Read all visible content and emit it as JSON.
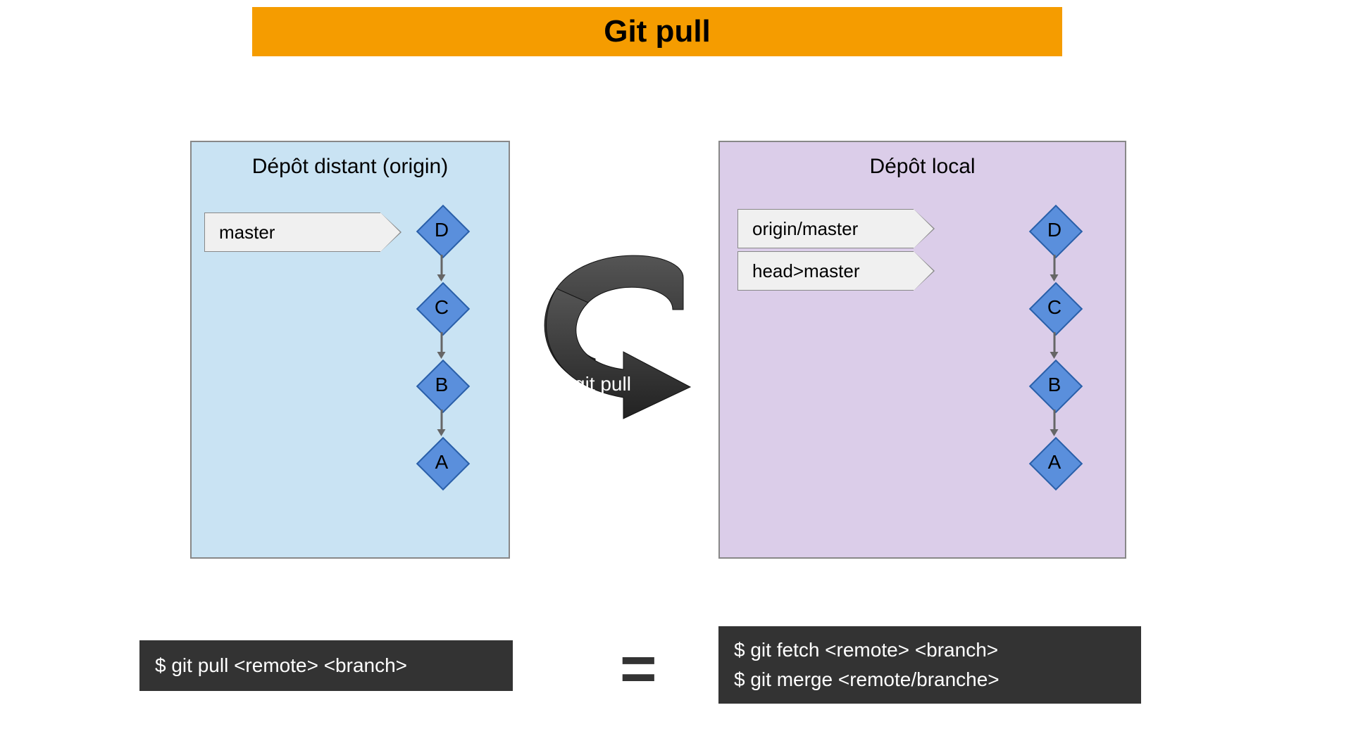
{
  "title": "Git pull",
  "remote": {
    "title": "Dépôt distant (origin)",
    "branch_label": "master",
    "commits": [
      "D",
      "C",
      "B",
      "A"
    ]
  },
  "local": {
    "title": "Dépôt local",
    "branch_label_top": "origin/master",
    "branch_label_bottom": "head>master",
    "commits": [
      "D",
      "C",
      "B",
      "A"
    ]
  },
  "arrow_label": "git pull",
  "cmd_left": "$ git pull <remote> <branch>",
  "cmd_right_1": "$ git fetch <remote> <branch>",
  "cmd_right_2": "$ git merge <remote/branche>",
  "equals": "="
}
